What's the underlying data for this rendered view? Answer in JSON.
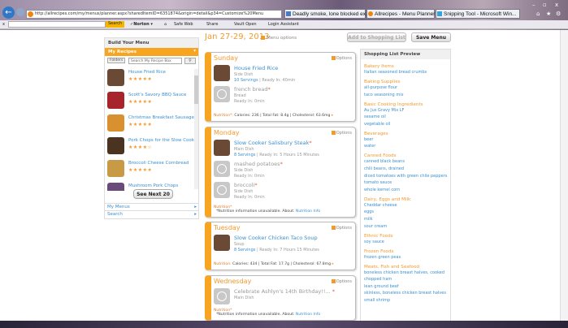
{
  "browser": {
    "url": "http://allrecipes.com/my/menus/planner.aspx?sharedItemID=6351874&origin=detail&p34=Customize%20Menu",
    "tabs": [
      "Deadly smoke, lone blocked ex...",
      "Allrecipes - Menu Planner",
      "Snipping Tool - Microsoft Win..."
    ],
    "toolbar": {
      "search": "Search",
      "norton": "Norton",
      "safeweb": "Safe Web",
      "share": "Share",
      "vault": "Vault Open",
      "login": "Login Assistant"
    }
  },
  "header": {
    "date": "Jan 27-29, 2013",
    "menu_options": "Menu options",
    "add_shopping": "Add to Shopping List",
    "save_menu": "Save Menu"
  },
  "left": {
    "title": "Build Your Menu",
    "section": "My Recipes",
    "folders": "Folders",
    "search_placeholder": "Search My Recipe Box",
    "recipes": [
      {
        "name": "House Fried Rice",
        "stars": "★★★★★",
        "color": "#6b4a35"
      },
      {
        "name": "Scott's Savory BBQ Sauce",
        "stars": "★★★★★",
        "color": "#a8242c"
      },
      {
        "name": "Christmas Breakfast Sausage...",
        "stars": "★★★★★",
        "color": "#d9902f"
      },
      {
        "name": "Pork Chops for the Slow Cook...",
        "stars": "★★★★☆",
        "color": "#4a3320"
      },
      {
        "name": "Broccoli Cheese Cornbread",
        "stars": "★★★★★",
        "color": "#c99a45"
      },
      {
        "name": "Mushroom Pork Chops",
        "stars": "",
        "color": "#6a4a7a"
      }
    ],
    "see_next": "See Next 20",
    "my_menus": "My Menus",
    "search": "Search"
  },
  "days": [
    {
      "name": "Sunday",
      "options": "Options",
      "dishes": [
        {
          "title": "House Fried Rice",
          "type": "Side Dish",
          "servings": "10 Servings",
          "ready": " | Ready In: 40min"
        },
        {
          "title": "french bread",
          "type": "Bread",
          "ready": "Ready In: 0min"
        }
      ],
      "nutrition": "Nutrition*:",
      "nutrition_text": " Calories: 236 | Total Fat: 8.4g | Cholesterol: 63.6mg"
    },
    {
      "name": "Monday",
      "options": "Options",
      "dishes": [
        {
          "title": "Slow Cooker Salisbury Steak",
          "type": "Main Dish",
          "servings": "8 Servings",
          "ready": " | Ready In: 5 Hours 15 Minutes"
        },
        {
          "title": "mashed potatoes",
          "type": "Side Dish",
          "ready": "Ready In: 0min"
        },
        {
          "title": "broccoli",
          "type": "Side Dish",
          "ready": "Ready In: 0min"
        }
      ],
      "nutrition": "Nutrition*",
      "unavailable": "*Nutrition information unavailable. About: ",
      "info_link": "Nutrition Info"
    },
    {
      "name": "Tuesday",
      "options": "Options",
      "dishes": [
        {
          "title": "Slow Cooker Chicken Taco Soup",
          "type": "Soup",
          "servings": "8 Servings",
          "ready": " | Ready In: 7 Hours 15 Minutes"
        }
      ],
      "nutrition": "Nutrition:",
      "nutrition_text": " Calories: 434 | Total Fat: 17.7g | Cholesterol: 67.8mg"
    },
    {
      "name": "Wednesday",
      "options": "Options",
      "dishes": [
        {
          "title": "Celebrate Ashlyn's 14th Birthday!!... ",
          "type": "Main Dish"
        }
      ],
      "nutrition": "Nutrition*",
      "unavailable": "*Nutrition information unavailable. About: ",
      "info_link": "Nutrition Info"
    }
  ],
  "shopping": {
    "title": "Shopping List Preview",
    "categories": [
      {
        "name": "Bakery Items",
        "items": [
          "Italian seasoned bread crumbs"
        ]
      },
      {
        "name": "Baking Supplies",
        "items": [
          "all-purpose flour",
          "taco seasoning mix"
        ]
      },
      {
        "name": "Basic Cooking Ingredients",
        "items": [
          "Au Jus Gravy Mix LF",
          "sesame oil",
          "vegetable oil"
        ]
      },
      {
        "name": "Beverages",
        "items": [
          "beer",
          "water"
        ]
      },
      {
        "name": "Canned Foods",
        "items": [
          "canned black beans",
          "chili beans, drained",
          "diced tomatoes with green chile peppers",
          "tomato sauce",
          "whole kernel corn"
        ]
      },
      {
        "name": "Dairy, Eggs and Milk",
        "items": [
          "Cheddar cheese",
          "eggs",
          "milk",
          "sour cream"
        ]
      },
      {
        "name": "Ethnic Foods",
        "items": [
          "soy sauce"
        ]
      },
      {
        "name": "Frozen Foods",
        "items": [
          "frozen green peas"
        ]
      },
      {
        "name": "Meats, Fish and Seafood",
        "items": [
          "boneless chicken breast halves, cooked",
          "chopped ham",
          "lean ground beef",
          "skinless, boneless chicken breast halves",
          "small shrimp"
        ]
      }
    ]
  }
}
